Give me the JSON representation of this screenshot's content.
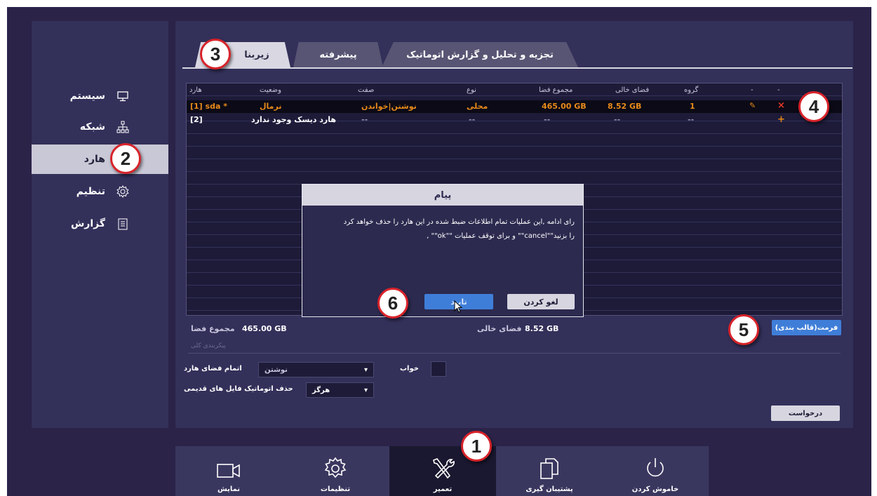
{
  "sidebar": {
    "items": [
      {
        "label": "سیستم",
        "icon": "monitor-icon"
      },
      {
        "label": "شبکه",
        "icon": "network-icon"
      },
      {
        "label": "هارد",
        "icon": "hdd-icon"
      },
      {
        "label": "تنظیم",
        "icon": "gear-icon"
      },
      {
        "label": "گزارش",
        "icon": "report-icon"
      }
    ],
    "active": "هارد"
  },
  "tabs": [
    "زیربنا",
    "پیشرفته",
    "تجزیه و تحلیل و گزارش اتوماتیک"
  ],
  "table": {
    "headers": [
      "هارد",
      "وضعیت",
      "صفت",
      "نوع",
      "مجموع فضا",
      "فضای خالی",
      "گروه",
      "-",
      "-"
    ],
    "rows": [
      {
        "hard": "[1] sda *",
        "status": "نرمال",
        "attr": "نوشتن|خواندن",
        "type": "محلی",
        "total": "465.00 GB",
        "free": "8.52 GB",
        "group": "1",
        "edit": "✎",
        "action": "×"
      },
      {
        "hard": "[2]",
        "status": "هارد دیسک وجود ندارد",
        "attr": "--",
        "type": "--",
        "total": "--",
        "free": "--",
        "group": "--",
        "edit": "",
        "action": "+"
      }
    ]
  },
  "dialog": {
    "title": "پیام",
    "line1": "رای ادامه ,این عملیات تمام اطلاعات ضبط شده در این هارد را حذف خواهد کرد",
    "line2": "را بزنید\"\"cancel\"\" و برای توقف عملیات  \"\"ok\"\" ,",
    "confirm": "تایید",
    "cancel": "لغو کردن"
  },
  "summary": {
    "total_label": "مجموع فضا",
    "total_value": "465.00 GB",
    "free_label": "فضای خالی",
    "free_value": "8.52 GB",
    "format_button": "(قالب بندی)فرمت"
  },
  "settings": {
    "section_label": "پیکربندی کلی",
    "hdd_full_label": "اتمام فضای هارد",
    "hdd_full_value": "نوشتن",
    "sleep_label": "خواب",
    "auto_delete_label": "حذف اتوماتیک فایل های قدیمی",
    "auto_delete_value": "هرگز",
    "apply_button": "درخواست"
  },
  "bottom_bar": [
    {
      "label": "نمایش",
      "icon": "camera-icon"
    },
    {
      "label": "تنظیمات",
      "icon": "gear-icon"
    },
    {
      "label": "تعمیر",
      "icon": "tools-icon"
    },
    {
      "label": "پشتیبان گیری",
      "icon": "copy-icon"
    },
    {
      "label": "خاموش کردن",
      "icon": "power-icon"
    }
  ],
  "markers": [
    "1",
    "2",
    "3",
    "4",
    "5",
    "6"
  ],
  "colors": {
    "background": "#2b2348",
    "panel": "#33305a",
    "accent": "#e88a1a",
    "primary_button": "#3f7ed8",
    "marker_border": "#d8232a"
  }
}
